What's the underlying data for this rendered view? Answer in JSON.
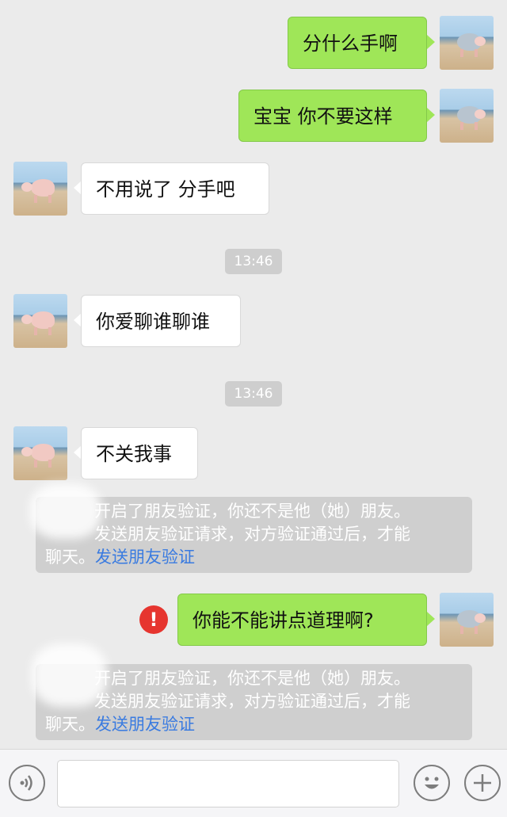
{
  "messages": [
    {
      "side": "me",
      "text": "分什么手啊"
    },
    {
      "side": "me",
      "text": "宝宝 你不要这样"
    },
    {
      "side": "them",
      "text": "不用说了 分手吧"
    },
    {
      "type": "time",
      "text": "13:46"
    },
    {
      "side": "them",
      "text": "你爱聊谁聊谁"
    },
    {
      "type": "time",
      "text": "13:46"
    },
    {
      "side": "them",
      "text": "不关我事"
    },
    {
      "type": "system",
      "line1": "开启了朋友验证，你还不是他（她）朋友。",
      "line2": "发送朋友验证请求，对方验证通过后，才能",
      "line3": "聊天。",
      "link": "发送朋友验证"
    },
    {
      "side": "me",
      "failed": true,
      "text": "你能不能讲点道理啊?"
    },
    {
      "type": "system",
      "line1": "开启了朋友验证，你还不是他（她）朋友。",
      "line2": "发送朋友验证请求，对方验证通过后，才能",
      "line3": "聊天。",
      "link": "发送朋友验证"
    }
  ],
  "failed_icon": "!",
  "toolbar": {
    "voice_icon": "voice-icon",
    "emoji_icon": "emoji-icon",
    "plus_icon": "plus-icon",
    "input_value": ""
  },
  "colors": {
    "me_bubble": "#9fe658",
    "them_bubble": "#ffffff",
    "link": "#3a7be0",
    "failed": "#e6352f"
  }
}
